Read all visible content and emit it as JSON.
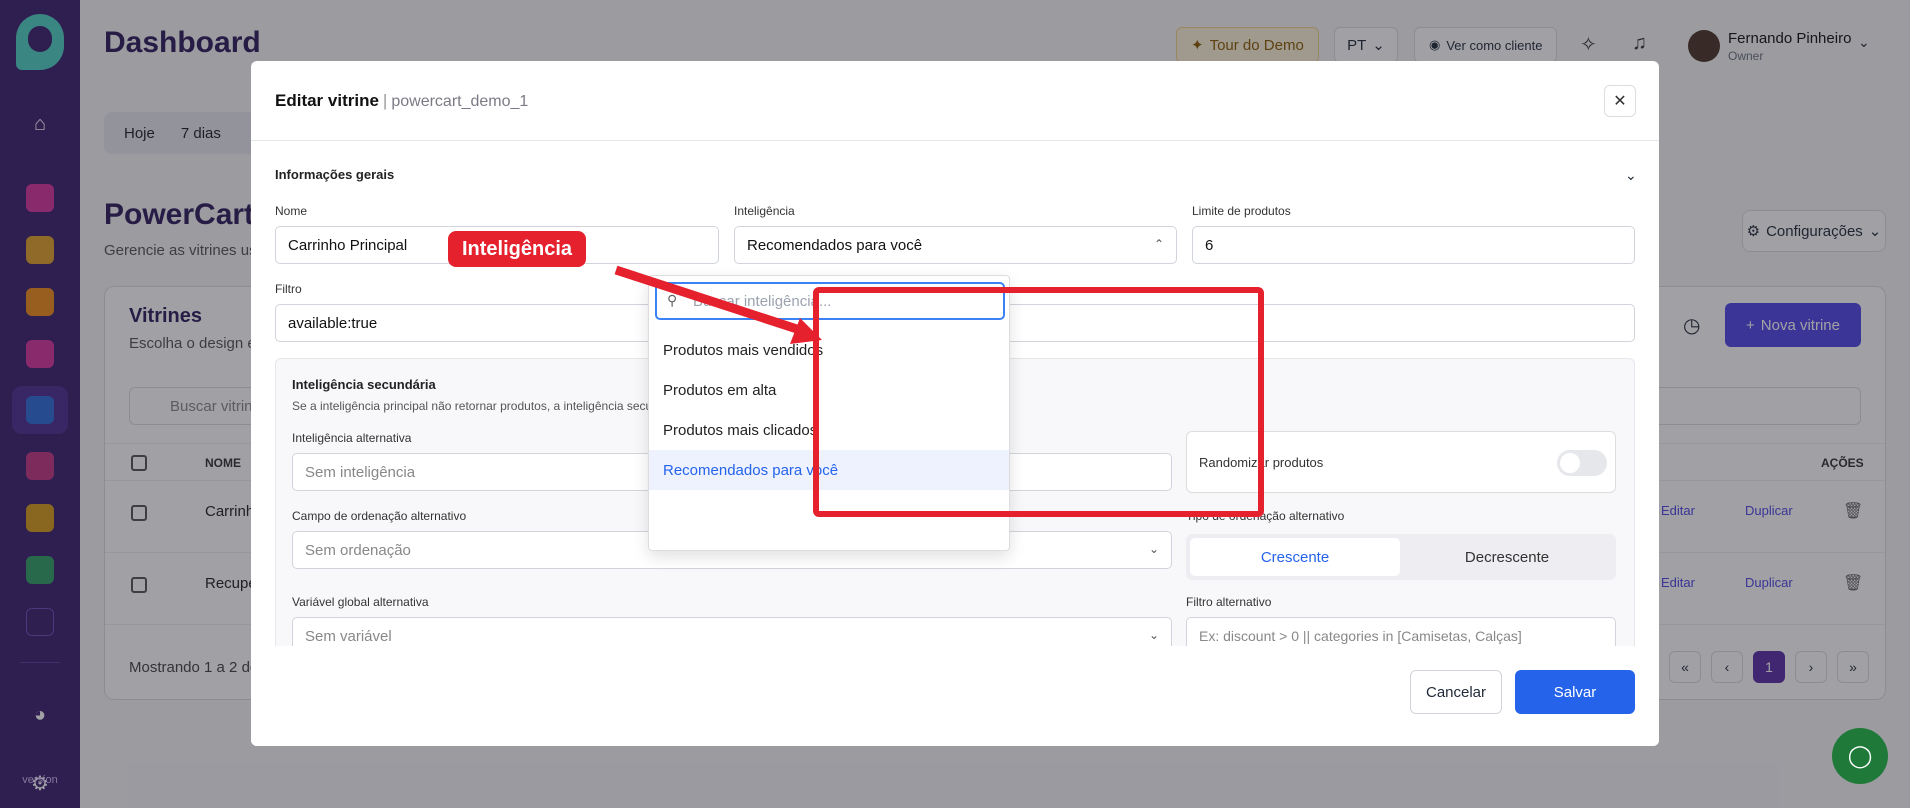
{
  "app": {
    "page_title": "Dashboard"
  },
  "topbar": {
    "tour": "Tour do Demo",
    "lang": "PT",
    "view_as": "Ver como cliente",
    "user_name": "Fernando Pinheiro",
    "user_role": "Owner"
  },
  "sidebar": {
    "version": "version"
  },
  "period": {
    "items": [
      "Hoje",
      "7 dias"
    ]
  },
  "powercart": {
    "title": "PowerCart",
    "subtitle": "Gerencie as vitrines us",
    "config": "Configurações"
  },
  "vitrines": {
    "title": "Vitrines",
    "subtitle": "Escolha o design e",
    "new_button": "Nova vitrine",
    "search_placeholder": "Buscar vitrin",
    "col_name": "NOME",
    "col_actions": "AÇÕES",
    "rows": [
      {
        "name": "Carrinh"
      },
      {
        "name": "Recupe"
      }
    ],
    "edit": "Editar",
    "duplicate": "Duplicar",
    "showing": "Mostrando 1 a 2 de",
    "page_current": "1"
  },
  "modal": {
    "title": "Editar vitrine",
    "separator": "|",
    "subtitle": "powercart_demo_1",
    "section": "Informações gerais",
    "nome_label": "Nome",
    "nome_value": "Carrinho Principal",
    "intel_label": "Inteligência",
    "intel_value": "Recomendados para você",
    "limite_label": "Limite de produtos",
    "limite_value": "6",
    "filtro_label": "Filtro",
    "filtro_value": "available:true",
    "sec2_title": "Inteligência secundária",
    "sec2_sub": "Se a inteligência principal não retornar produtos, a inteligência secundária é",
    "alt_intel_label": "Inteligência alternativa",
    "alt_intel_placeholder": "Sem inteligência",
    "randomize": "Randomizar produtos",
    "alt_sort_field_label": "Campo de ordenação alternativo",
    "alt_sort_field_placeholder": "Sem ordenação",
    "alt_sort_type_label": "Tipo de ordenação alternativo",
    "asc": "Crescente",
    "desc": "Decrescente",
    "alt_var_label": "Variável global alternativa",
    "alt_var_placeholder": "Sem variável",
    "alt_filter_label": "Filtro alternativo",
    "alt_filter_placeholder": "Ex: discount > 0 || categories in [Camisetas, Calças]",
    "cancel": "Cancelar",
    "save": "Salvar"
  },
  "dropdown": {
    "search_placeholder": "Buscar inteligência...",
    "options": [
      "Produtos mais vendidos",
      "Produtos em alta",
      "Produtos mais clicados",
      "Recomendados para você"
    ],
    "selected_index": 3
  },
  "annotation": {
    "callout": "Inteligência",
    "color": "#e5212e"
  },
  "colors": {
    "sidebar": "#3b1f6e",
    "primary": "#2563eb",
    "accent": "#4f46e5"
  }
}
